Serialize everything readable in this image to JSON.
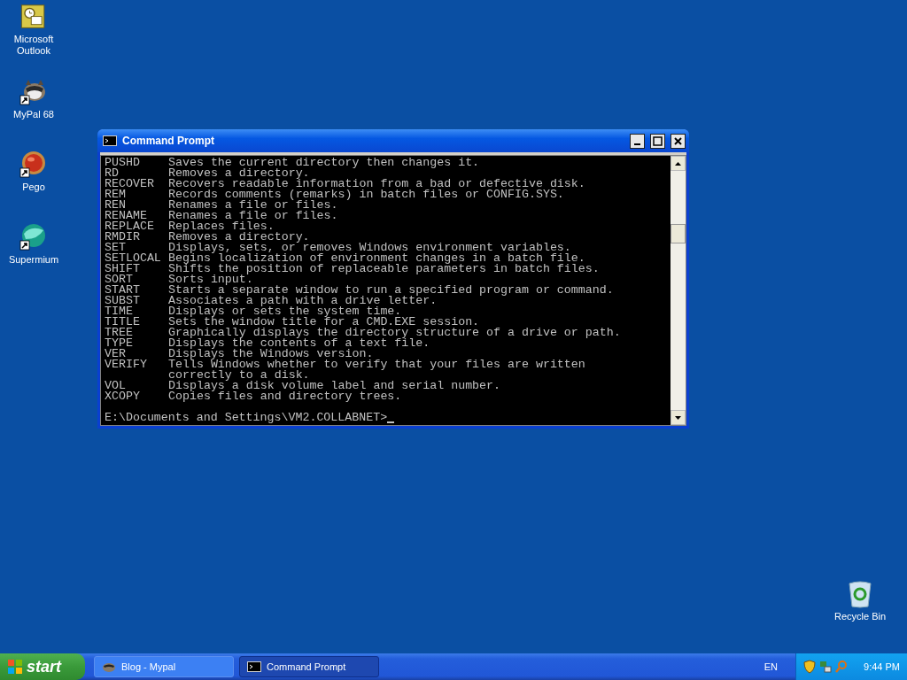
{
  "desktop_icons": [
    {
      "label": "Microsoft Outlook",
      "kind": "outlook",
      "shortcut": false
    },
    {
      "label": "MyPal 68",
      "kind": "raccoon",
      "shortcut": true
    },
    {
      "label": "Pego",
      "kind": "orb",
      "shortcut": true
    },
    {
      "label": "Supermium",
      "kind": "sphere",
      "shortcut": true
    }
  ],
  "recycle_bin": {
    "label": "Recycle Bin"
  },
  "window": {
    "title": "Command Prompt",
    "active": true,
    "lines": [
      {
        "command": "PUSHD",
        "description": "Saves the current directory then changes it."
      },
      {
        "command": "RD",
        "description": "Removes a directory."
      },
      {
        "command": "RECOVER",
        "description": "Recovers readable information from a bad or defective disk."
      },
      {
        "command": "REM",
        "description": "Records comments (remarks) in batch files or CONFIG.SYS."
      },
      {
        "command": "REN",
        "description": "Renames a file or files."
      },
      {
        "command": "RENAME",
        "description": "Renames a file or files."
      },
      {
        "command": "REPLACE",
        "description": "Replaces files."
      },
      {
        "command": "RMDIR",
        "description": "Removes a directory."
      },
      {
        "command": "SET",
        "description": "Displays, sets, or removes Windows environment variables."
      },
      {
        "command": "SETLOCAL",
        "description": "Begins localization of environment changes in a batch file."
      },
      {
        "command": "SHIFT",
        "description": "Shifts the position of replaceable parameters in batch files."
      },
      {
        "command": "SORT",
        "description": "Sorts input."
      },
      {
        "command": "START",
        "description": "Starts a separate window to run a specified program or command."
      },
      {
        "command": "SUBST",
        "description": "Associates a path with a drive letter."
      },
      {
        "command": "TIME",
        "description": "Displays or sets the system time."
      },
      {
        "command": "TITLE",
        "description": "Sets the window title for a CMD.EXE session."
      },
      {
        "command": "TREE",
        "description": "Graphically displays the directory structure of a drive or path."
      },
      {
        "command": "TYPE",
        "description": "Displays the contents of a text file."
      },
      {
        "command": "VER",
        "description": "Displays the Windows version."
      },
      {
        "command": "VERIFY",
        "description": "Tells Windows whether to verify that your files are written",
        "continuation": "correctly to a disk."
      },
      {
        "command": "VOL",
        "description": "Displays a disk volume label and serial number."
      },
      {
        "command": "XCOPY",
        "description": "Copies files and directory trees."
      }
    ],
    "prompt": "E:\\Documents and Settings\\VM2.COLLABNET>"
  },
  "taskbar": {
    "start": "start",
    "tasks": [
      {
        "label": "Blog - Mypal",
        "kind": "browser",
        "selected": false
      },
      {
        "label": "Command Prompt",
        "kind": "console",
        "selected": true
      }
    ],
    "language": "EN",
    "clock": "9:44 PM"
  }
}
